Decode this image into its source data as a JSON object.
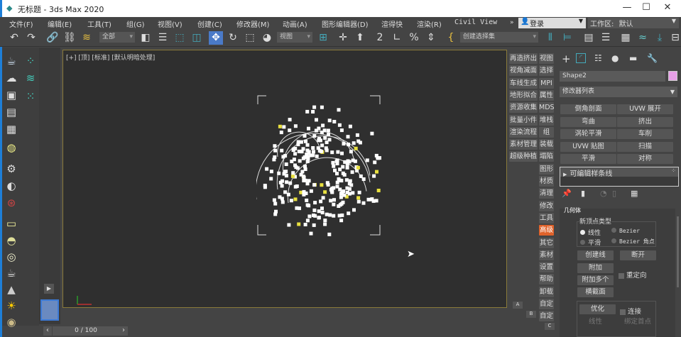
{
  "window": {
    "title": "无标题 - 3ds Max 2020",
    "controls": [
      "—",
      "☐",
      "✕"
    ]
  },
  "menu": {
    "items": [
      "文件(F)",
      "编辑(E)",
      "工具(T)",
      "组(G)",
      "视图(V)",
      "创建(C)",
      "修改器(M)",
      "动画(A)",
      "图形编辑器(D)",
      "渲得快",
      "渲染(R)",
      "Civil View"
    ],
    "login": "登录",
    "workspace_label": "工作区:",
    "workspace_value": "默认"
  },
  "toolbar": {
    "selection_filter": "全部",
    "reference_coord": "视图",
    "named_selection": "创建选择集"
  },
  "viewport": {
    "label": "[+] [顶] [标准] [默认明暗处理]"
  },
  "timeline": {
    "frame": "0 / 100"
  },
  "side_buttons": {
    "left": [
      "再造挤出",
      "视角减面",
      "车线生成",
      "地形拟合",
      "资源收集",
      "批量小件",
      "渲染流程",
      "素材管理",
      "超级种植"
    ],
    "right": [
      "视图",
      "选择",
      "MPI",
      "属性",
      "MDS",
      "堆栈",
      "组",
      "装载",
      "塌陷",
      "图形",
      "材质",
      "清理",
      "修改",
      "工具",
      "高级",
      "其它",
      "素材",
      "设置",
      "帮助",
      "卸载",
      "自定",
      "自定"
    ],
    "active": "高级",
    "active_color": "#e0622a",
    "ab": [
      "A",
      "B",
      "C"
    ]
  },
  "command_panel": {
    "object_name": "Shape2",
    "object_color": "#e8a0e8",
    "modifier_list": "修改器列表",
    "modifier_buttons": [
      "倒角剖面",
      "UVW 展开",
      "弯曲",
      "挤出",
      "涡轮平滑",
      "车削",
      "UVW 贴图",
      "扫描",
      "平滑",
      "对称"
    ],
    "stack_item": "可编辑样条线",
    "rollout_title": "几何体",
    "new_vertex_type": {
      "label": "新顶点类型",
      "options": [
        "线性",
        "Bezier",
        "平滑",
        "Bezier 角点"
      ],
      "selected": "线性"
    },
    "buttons": {
      "create_line": "创建线",
      "break": "断开",
      "attach": "附加",
      "reorient": "重定向",
      "attach_mult": "附加多个",
      "cross_section": "横截面",
      "refine": "优化",
      "connect": "连接",
      "linear": "线性",
      "bind_first": "绑定首点"
    }
  }
}
